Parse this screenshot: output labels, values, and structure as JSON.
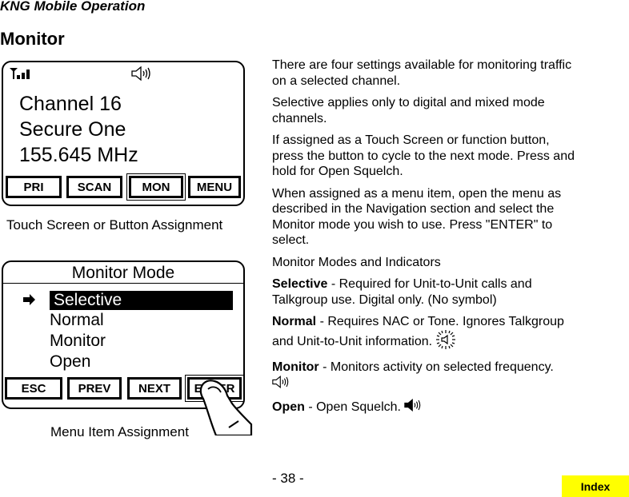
{
  "header": {
    "title": "KNG Mobile Operation",
    "section_title": "Monitor"
  },
  "screen1": {
    "icons": [
      "signal-strength-icon",
      "speaker-monitor-icon"
    ],
    "lines": [
      "Channel 16",
      "Secure One",
      "155.645 MHz"
    ],
    "softkeys": [
      {
        "label": "PRI",
        "selected": false
      },
      {
        "label": "SCAN",
        "selected": false
      },
      {
        "label": "MON",
        "selected": true
      },
      {
        "label": "MENU",
        "selected": false
      }
    ],
    "caption": "Touch Screen or Button Assignment"
  },
  "screen2": {
    "title": "Monitor Mode",
    "items": [
      {
        "label": "Selective",
        "selected": true
      },
      {
        "label": "Normal",
        "selected": false
      },
      {
        "label": "Monitor",
        "selected": false
      },
      {
        "label": "Open",
        "selected": false
      }
    ],
    "softkeys": [
      {
        "label": "ESC",
        "selected": false
      },
      {
        "label": "PREV",
        "selected": false
      },
      {
        "label": "NEXT",
        "selected": false
      },
      {
        "label": "ENTER",
        "selected": true
      }
    ],
    "caption": "Menu Item Assignment"
  },
  "body": {
    "p1": "There are four settings available for monitoring traffic on a selected channel.",
    "p2": "Selective applies only to digital and mixed mode channels.",
    "p3": "If assigned as a Touch Screen or function button, press the button to cycle to the next mode. Press and hold for Open Squelch.",
    "p4": "When assigned as a menu item, open the menu as described in the Navigation section and select the Monitor mode you wish to use. Press \"ENTER\" to select.",
    "p5": "Monitor Modes and Indicators",
    "modes": [
      {
        "term": "Selective",
        "desc": " - Required for Unit-to-Unit calls and Talkgroup use. Digital only. (No symbol)",
        "icon": ""
      },
      {
        "term": "Normal",
        "desc": " - Requires NAC or Tone. Ignores Talkgroup and Unit-to-Unit information. ",
        "icon": "speaker-flashing-icon"
      },
      {
        "term": "Monitor",
        "desc": " -  Monitors activity on selected frequency. ",
        "icon": "speaker-outline-icon"
      },
      {
        "term": "Open",
        "desc": " - Open Squelch. ",
        "icon": "speaker-filled-icon"
      }
    ]
  },
  "footer": {
    "page_number": "- 38 -",
    "index_label": "Index",
    "index_color": "#ffff00"
  }
}
